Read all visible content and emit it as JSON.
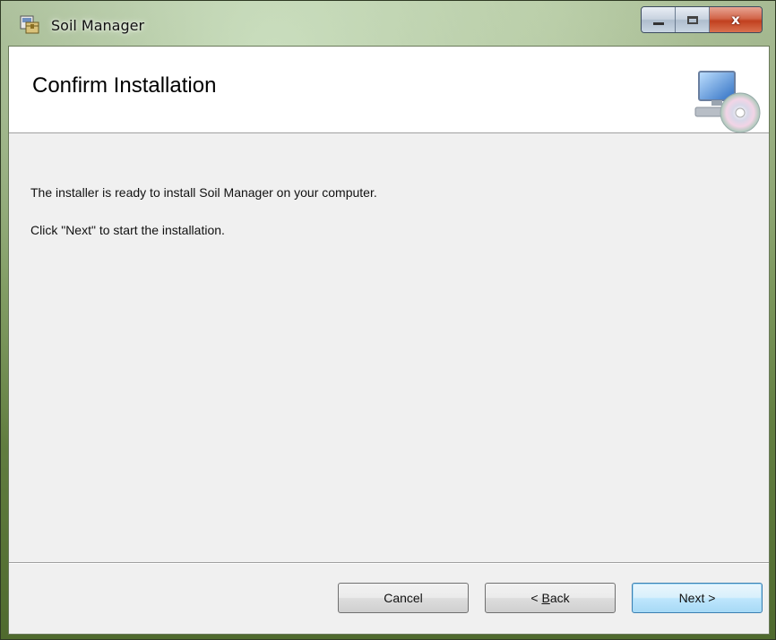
{
  "window": {
    "title": "Soil Manager",
    "icon": "installer-package-icon",
    "controls": {
      "minimize": "minimize-icon",
      "maximize": "maximize-icon",
      "close_glyph": "x"
    }
  },
  "header": {
    "title": "Confirm Installation",
    "icon": "computer-cd-icon"
  },
  "body": {
    "line1": "The installer is ready to install Soil Manager on your computer.",
    "line2": "Click \"Next\" to start the installation."
  },
  "buttons": {
    "cancel": "Cancel",
    "back_prefix": "< ",
    "back_mnemonic": "B",
    "back_rest": "ack",
    "next": "Next >"
  },
  "colors": {
    "client_bg": "#f0f0f0",
    "header_bg": "#ffffff",
    "default_button_border": "#3c7fb1"
  }
}
